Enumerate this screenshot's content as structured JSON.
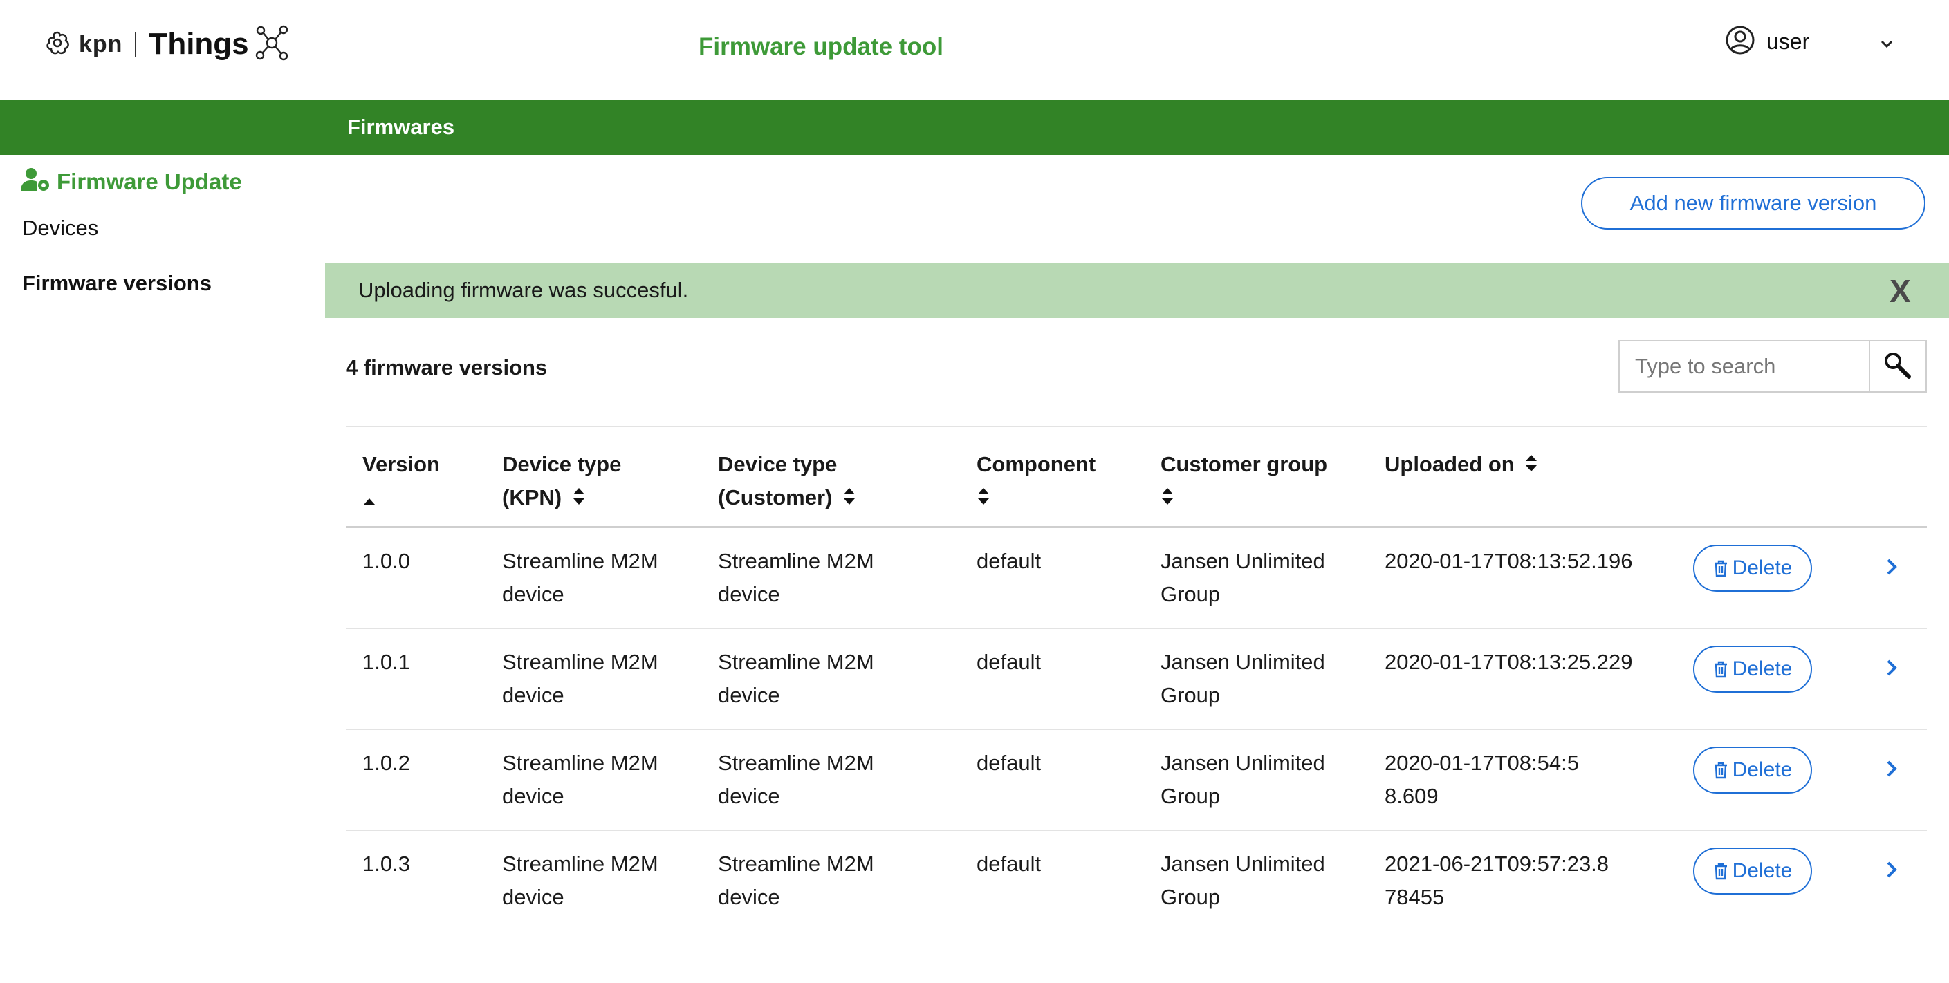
{
  "header": {
    "logo_brand": "kpn",
    "logo_product": "Things",
    "app_title": "Firmware update tool",
    "user_label": "user"
  },
  "greenbar": {
    "title": "Firmwares"
  },
  "sidebar": {
    "section_title": "Firmware Update",
    "items": [
      {
        "label": "Devices"
      },
      {
        "label": "Firmware versions"
      }
    ]
  },
  "actions": {
    "add_label": "Add new firmware version"
  },
  "alert": {
    "message": "Uploading firmware was succesful.",
    "close_label": "X"
  },
  "list": {
    "count_label": "4 firmware versions",
    "search_placeholder": "Type to search"
  },
  "table": {
    "headers": {
      "version": "Version",
      "device_type_kpn_1": "Device type",
      "device_type_kpn_2": "(KPN)",
      "device_type_customer_1": "Device type",
      "device_type_customer_2": "(Customer)",
      "component": "Component",
      "customer_group": "Customer group",
      "uploaded_on": "Uploaded on"
    },
    "delete_label": "Delete",
    "rows": [
      {
        "version": "1.0.0",
        "device_type_kpn": "Streamline M2M device",
        "device_type_customer": "Streamline M2M device",
        "component": "default",
        "customer_group": "Jansen Unlimited Group",
        "uploaded_on": "2020-01-17T08:13:52.196"
      },
      {
        "version": "1.0.1",
        "device_type_kpn": "Streamline M2M device",
        "device_type_customer": "Streamline M2M device",
        "component": "default",
        "customer_group": "Jansen Unlimited Group",
        "uploaded_on": "2020-01-17T08:13:25.229"
      },
      {
        "version": "1.0.2",
        "device_type_kpn": "Streamline M2M device",
        "device_type_customer": "Streamline M2M device",
        "component": "default",
        "customer_group": "Jansen Unlimited Group",
        "uploaded_on": "2020-01-17T08:54:58.609"
      },
      {
        "version": "1.0.3",
        "device_type_kpn": "Streamline M2M device",
        "device_type_customer": "Streamline M2M device",
        "component": "default",
        "customer_group": "Jansen Unlimited Group",
        "uploaded_on": "2021-06-21T09:57:23.878455"
      }
    ]
  },
  "colors": {
    "brand_green": "#328326",
    "title_green": "#3e9a38",
    "alert_bg": "#b8d9b4",
    "link_blue": "#1f6fd6"
  },
  "icons": [
    "kpn-logo-icon",
    "things-network-icon",
    "user-circle-icon",
    "chevron-down-icon",
    "user-gear-icon",
    "search-icon",
    "sort-icon",
    "trash-icon",
    "chevron-right-icon"
  ]
}
